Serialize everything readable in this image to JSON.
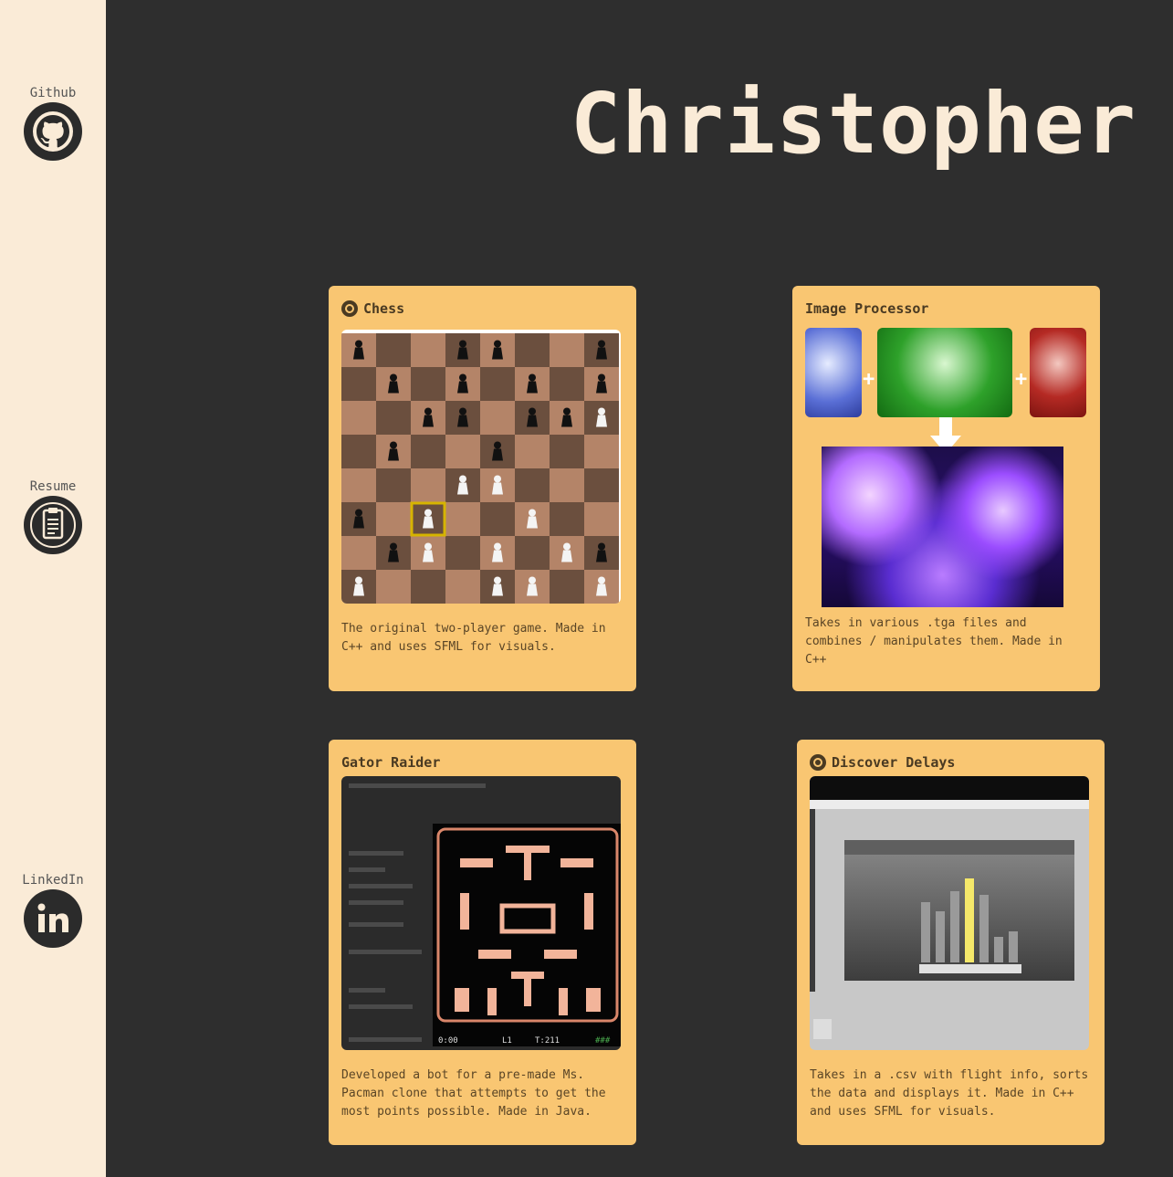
{
  "sidebar": {
    "github_label": "Github",
    "resume_label": "Resume",
    "linkedin_label": "LinkedIn"
  },
  "header": {
    "title": "Christopher"
  },
  "projects": [
    {
      "title": "Chess",
      "has_github_icon": true,
      "description": "The original two-player game. Made in C++ and uses SFML for visuals."
    },
    {
      "title": "Image Processor",
      "has_github_icon": false,
      "description": "Takes in various .tga files and combines / manipulates them. Made in C++"
    },
    {
      "title": "Gator Raider",
      "has_github_icon": false,
      "description": "Developed a bot for a pre-made Ms. Pacman clone that attempts to get the most points possible. Made in Java."
    },
    {
      "title": "Discover Delays",
      "has_github_icon": true,
      "description": "Takes in a .csv with flight info, sorts the data and displays it. Made in C++ and uses SFML for visuals."
    }
  ],
  "colors": {
    "page_background": "#2e2e2e",
    "sidebar_background": "#faebd7",
    "card_background": "#f9c672",
    "title_color": "#faebd7"
  }
}
